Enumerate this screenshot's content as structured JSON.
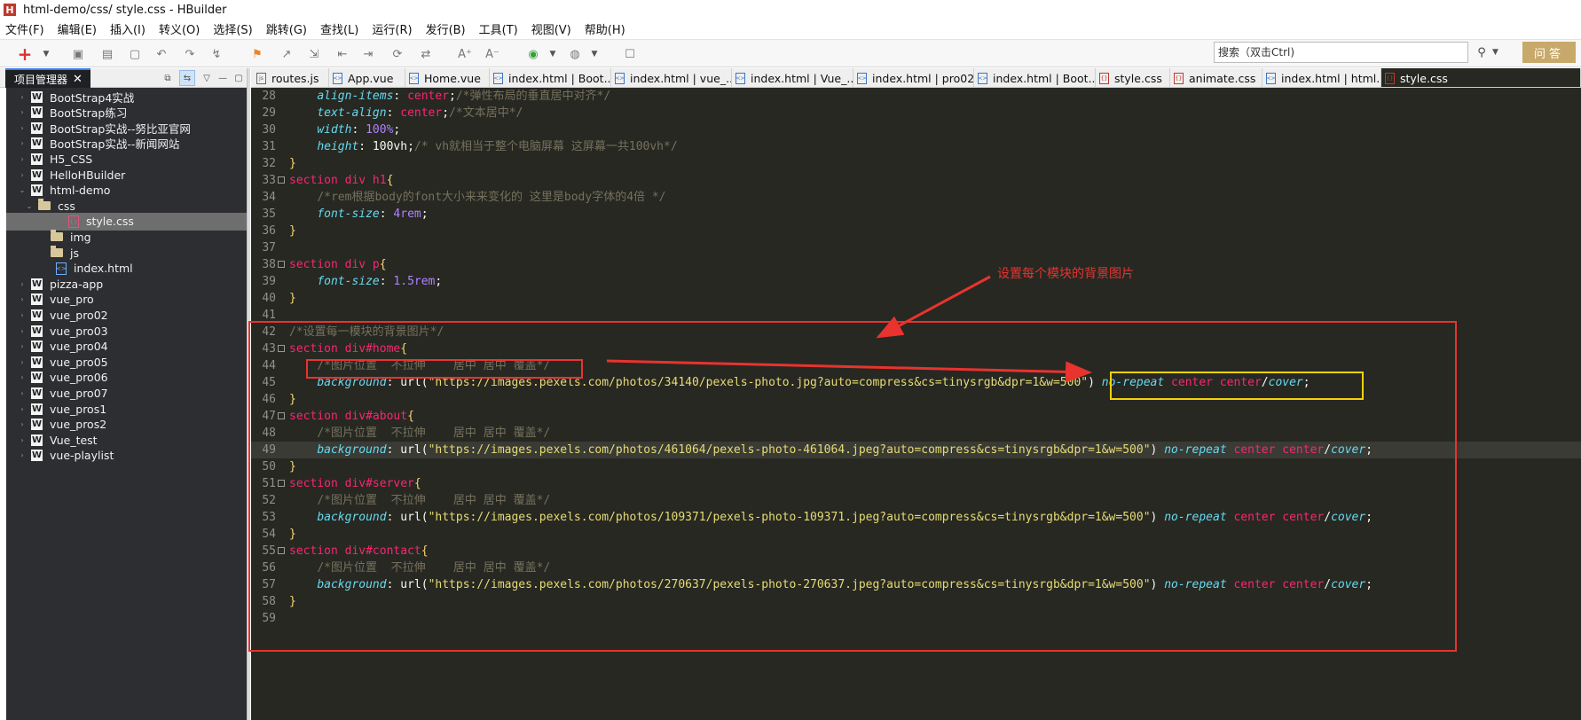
{
  "window": {
    "title": "html-demo/css/ style.css  -  HBuilder",
    "app_icon": "H"
  },
  "menu": [
    "文件(F)",
    "编辑(E)",
    "插入(I)",
    "转义(O)",
    "选择(S)",
    "跳转(G)",
    "查找(L)",
    "运行(R)",
    "发行(B)",
    "工具(T)",
    "视图(V)",
    "帮助(H)"
  ],
  "search": {
    "value": "搜索（双击Ctrl)"
  },
  "ask_button": "问答",
  "sidebar": {
    "tab_label": "项目管理器",
    "close": "✕",
    "items": [
      {
        "label": "BootStrap4实战",
        "type": "project",
        "twisty": "›"
      },
      {
        "label": "BootStrap练习",
        "type": "project",
        "twisty": "›"
      },
      {
        "label": "BootStrap实战--努比亚官网",
        "type": "project",
        "twisty": "›"
      },
      {
        "label": "BootStrap实战--新闻网站",
        "type": "project",
        "twisty": "›"
      },
      {
        "label": "H5_CSS",
        "type": "project",
        "twisty": "›"
      },
      {
        "label": "HelloHBuilder",
        "type": "project",
        "twisty": "›"
      },
      {
        "label": "html-demo",
        "type": "project",
        "twisty": "⌄"
      },
      {
        "label": "css",
        "type": "folder",
        "twisty": "⌄"
      },
      {
        "label": "style.css",
        "type": "cssfile",
        "twisty": ""
      },
      {
        "label": "img",
        "type": "folder",
        "twisty": ""
      },
      {
        "label": "js",
        "type": "folder",
        "twisty": ""
      },
      {
        "label": "index.html",
        "type": "htmlfile",
        "twisty": ""
      },
      {
        "label": "pizza-app",
        "type": "project",
        "twisty": "›"
      },
      {
        "label": "vue_pro",
        "type": "project",
        "twisty": "›"
      },
      {
        "label": "vue_pro02",
        "type": "project",
        "twisty": "›"
      },
      {
        "label": "vue_pro03",
        "type": "project",
        "twisty": "›"
      },
      {
        "label": "vue_pro04",
        "type": "project",
        "twisty": "›"
      },
      {
        "label": "vue_pro05",
        "type": "project",
        "twisty": "›"
      },
      {
        "label": "vue_pro06",
        "type": "project",
        "twisty": "›"
      },
      {
        "label": "vue_pro07",
        "type": "project",
        "twisty": "›"
      },
      {
        "label": "vue_pros1",
        "type": "project",
        "twisty": "›"
      },
      {
        "label": "vue_pros2",
        "type": "project",
        "twisty": "›"
      },
      {
        "label": "Vue_test",
        "type": "project",
        "twisty": "›"
      },
      {
        "label": "vue-playlist",
        "type": "project",
        "twisty": "›"
      }
    ]
  },
  "tabs": [
    {
      "label": "routes.js",
      "kind": "js"
    },
    {
      "label": "App.vue",
      "kind": "html"
    },
    {
      "label": "Home.vue",
      "kind": "html"
    },
    {
      "label": "index.html | Boot...",
      "kind": "html"
    },
    {
      "label": "index.html | vue_...",
      "kind": "html"
    },
    {
      "label": "index.html | Vue_...",
      "kind": "html"
    },
    {
      "label": "index.html | pro02",
      "kind": "html"
    },
    {
      "label": "index.html | Boot...",
      "kind": "html"
    },
    {
      "label": "style.css",
      "kind": "css"
    },
    {
      "label": "animate.css",
      "kind": "css"
    },
    {
      "label": "index.html | html...",
      "kind": "html"
    },
    {
      "label": "style.css",
      "kind": "css"
    }
  ],
  "editor": {
    "lines": [
      {
        "n": "28",
        "fold": false,
        "cur": false,
        "tokens": [
          [
            "w",
            "    "
          ],
          [
            "p",
            "align-items"
          ],
          [
            "w",
            ": "
          ],
          [
            "v",
            "center"
          ],
          [
            "w",
            ";"
          ],
          [
            "c",
            "/*弹性布局的垂直居中对齐*/"
          ]
        ]
      },
      {
        "n": "29",
        "fold": false,
        "cur": false,
        "tokens": [
          [
            "w",
            "    "
          ],
          [
            "p",
            "text-align"
          ],
          [
            "w",
            ": "
          ],
          [
            "v",
            "center"
          ],
          [
            "w",
            ";"
          ],
          [
            "c",
            "/*文本居中*/"
          ]
        ]
      },
      {
        "n": "30",
        "fold": false,
        "cur": false,
        "tokens": [
          [
            "w",
            "    "
          ],
          [
            "p",
            "width"
          ],
          [
            "w",
            ": "
          ],
          [
            "u",
            "100%"
          ],
          [
            "w",
            ";"
          ]
        ]
      },
      {
        "n": "31",
        "fold": false,
        "cur": false,
        "tokens": [
          [
            "w",
            "    "
          ],
          [
            "p",
            "height"
          ],
          [
            "w",
            ": 100vh;"
          ],
          [
            "c",
            "/* vh就相当于整个电脑屏幕 这屏幕一共100vh*/"
          ]
        ]
      },
      {
        "n": "32",
        "fold": false,
        "cur": false,
        "tokens": [
          [
            "b",
            "}"
          ]
        ]
      },
      {
        "n": "33",
        "fold": true,
        "cur": false,
        "tokens": [
          [
            "s",
            "section div h1"
          ],
          [
            "b",
            "{"
          ]
        ]
      },
      {
        "n": "34",
        "fold": false,
        "cur": false,
        "tokens": [
          [
            "w",
            "    "
          ],
          [
            "c",
            "/*rem根据body的font大小来来变化的 这里是body字体的4倍 */"
          ]
        ]
      },
      {
        "n": "35",
        "fold": false,
        "cur": false,
        "tokens": [
          [
            "w",
            "    "
          ],
          [
            "p",
            "font-size"
          ],
          [
            "w",
            ": "
          ],
          [
            "u",
            "4rem"
          ],
          [
            "w",
            ";"
          ]
        ]
      },
      {
        "n": "36",
        "fold": false,
        "cur": false,
        "tokens": [
          [
            "b",
            "}"
          ]
        ]
      },
      {
        "n": "37",
        "fold": false,
        "cur": false,
        "tokens": []
      },
      {
        "n": "38",
        "fold": true,
        "cur": false,
        "tokens": [
          [
            "s",
            "section div p"
          ],
          [
            "b",
            "{"
          ]
        ]
      },
      {
        "n": "39",
        "fold": false,
        "cur": false,
        "tokens": [
          [
            "w",
            "    "
          ],
          [
            "p",
            "font-size"
          ],
          [
            "w",
            ": "
          ],
          [
            "u",
            "1.5rem"
          ],
          [
            "w",
            ";"
          ]
        ]
      },
      {
        "n": "40",
        "fold": false,
        "cur": false,
        "tokens": [
          [
            "b",
            "}"
          ]
        ]
      },
      {
        "n": "41",
        "fold": false,
        "cur": false,
        "tokens": []
      },
      {
        "n": "42",
        "fold": false,
        "cur": false,
        "tokens": [
          [
            "c",
            "/*设置每一模块的背景图片*/"
          ]
        ]
      },
      {
        "n": "43",
        "fold": true,
        "cur": false,
        "tokens": [
          [
            "s",
            "section div#home"
          ],
          [
            "b",
            "{"
          ]
        ]
      },
      {
        "n": "44",
        "fold": false,
        "cur": false,
        "tokens": [
          [
            "w",
            "    "
          ],
          [
            "c",
            "/*图片位置  不拉伸    居中 居中 覆盖*/"
          ]
        ]
      },
      {
        "n": "45",
        "fold": false,
        "cur": false,
        "tokens": [
          [
            "w",
            "    "
          ],
          [
            "p",
            "background"
          ],
          [
            "w",
            ": url("
          ],
          [
            "str",
            "\"https://images.pexels.com/photos/34140/pexels-photo.jpg?auto=compress&cs=tinysrgb&dpr=1&w=500\""
          ],
          [
            "w",
            ") "
          ],
          [
            "k",
            "no-repeat"
          ],
          [
            "w",
            " "
          ],
          [
            "v",
            "center center"
          ],
          [
            "w",
            "/"
          ],
          [
            "k",
            "cover"
          ],
          [
            "w",
            ";"
          ]
        ]
      },
      {
        "n": "46",
        "fold": false,
        "cur": false,
        "tokens": [
          [
            "b",
            "}"
          ]
        ]
      },
      {
        "n": "47",
        "fold": true,
        "cur": false,
        "tokens": [
          [
            "s",
            "section div#about"
          ],
          [
            "b",
            "{"
          ]
        ]
      },
      {
        "n": "48",
        "fold": false,
        "cur": false,
        "tokens": [
          [
            "w",
            "    "
          ],
          [
            "c",
            "/*图片位置  不拉伸    居中 居中 覆盖*/"
          ]
        ]
      },
      {
        "n": "49",
        "fold": false,
        "cur": true,
        "tokens": [
          [
            "w",
            "    "
          ],
          [
            "p",
            "background"
          ],
          [
            "w",
            ": url("
          ],
          [
            "str",
            "\"https://images.pexels.com/photos/461064/pexels-photo-461064.jpeg?auto=compress&cs=tinysrgb&dpr=1&w=500\""
          ],
          [
            "w",
            ") "
          ],
          [
            "k",
            "no-repeat"
          ],
          [
            "w",
            " "
          ],
          [
            "v",
            "center center"
          ],
          [
            "w",
            "/"
          ],
          [
            "k",
            "cover"
          ],
          [
            "w",
            ";"
          ]
        ]
      },
      {
        "n": "50",
        "fold": false,
        "cur": false,
        "tokens": [
          [
            "b",
            "}"
          ]
        ]
      },
      {
        "n": "51",
        "fold": true,
        "cur": false,
        "tokens": [
          [
            "s",
            "section div#server"
          ],
          [
            "b",
            "{"
          ]
        ]
      },
      {
        "n": "52",
        "fold": false,
        "cur": false,
        "tokens": [
          [
            "w",
            "    "
          ],
          [
            "c",
            "/*图片位置  不拉伸    居中 居中 覆盖*/"
          ]
        ]
      },
      {
        "n": "53",
        "fold": false,
        "cur": false,
        "tokens": [
          [
            "w",
            "    "
          ],
          [
            "p",
            "background"
          ],
          [
            "w",
            ": url("
          ],
          [
            "str",
            "\"https://images.pexels.com/photos/109371/pexels-photo-109371.jpeg?auto=compress&cs=tinysrgb&dpr=1&w=500\""
          ],
          [
            "w",
            ") "
          ],
          [
            "k",
            "no-repeat"
          ],
          [
            "w",
            " "
          ],
          [
            "v",
            "center center"
          ],
          [
            "w",
            "/"
          ],
          [
            "k",
            "cover"
          ],
          [
            "w",
            ";"
          ]
        ]
      },
      {
        "n": "54",
        "fold": false,
        "cur": false,
        "tokens": [
          [
            "b",
            "}"
          ]
        ]
      },
      {
        "n": "55",
        "fold": true,
        "cur": false,
        "tokens": [
          [
            "s",
            "section div#contact"
          ],
          [
            "b",
            "{"
          ]
        ]
      },
      {
        "n": "56",
        "fold": false,
        "cur": false,
        "tokens": [
          [
            "w",
            "    "
          ],
          [
            "c",
            "/*图片位置  不拉伸    居中 居中 覆盖*/"
          ]
        ]
      },
      {
        "n": "57",
        "fold": false,
        "cur": false,
        "tokens": [
          [
            "w",
            "    "
          ],
          [
            "p",
            "background"
          ],
          [
            "w",
            ": url("
          ],
          [
            "str",
            "\"https://images.pexels.com/photos/270637/pexels-photo-270637.jpeg?auto=compress&cs=tinysrgb&dpr=1&w=500\""
          ],
          [
            "w",
            ") "
          ],
          [
            "k",
            "no-repeat"
          ],
          [
            "w",
            " "
          ],
          [
            "v",
            "center center"
          ],
          [
            "w",
            "/"
          ],
          [
            "k",
            "cover"
          ],
          [
            "w",
            ";"
          ]
        ]
      },
      {
        "n": "58",
        "fold": false,
        "cur": false,
        "tokens": [
          [
            "b",
            "}"
          ]
        ]
      },
      {
        "n": "59",
        "fold": false,
        "cur": false,
        "tokens": []
      }
    ]
  },
  "annotation": {
    "text": "设置每个模块的背景图片"
  },
  "colors": {
    "annotation_red": "#e8332f",
    "highlight_yellow": "#f5d20a",
    "editor_bg": "#272822",
    "sidebar_bg": "#2c2e31",
    "accent_blue": "#3c7ef0",
    "ask_button": "#c8a96c"
  }
}
